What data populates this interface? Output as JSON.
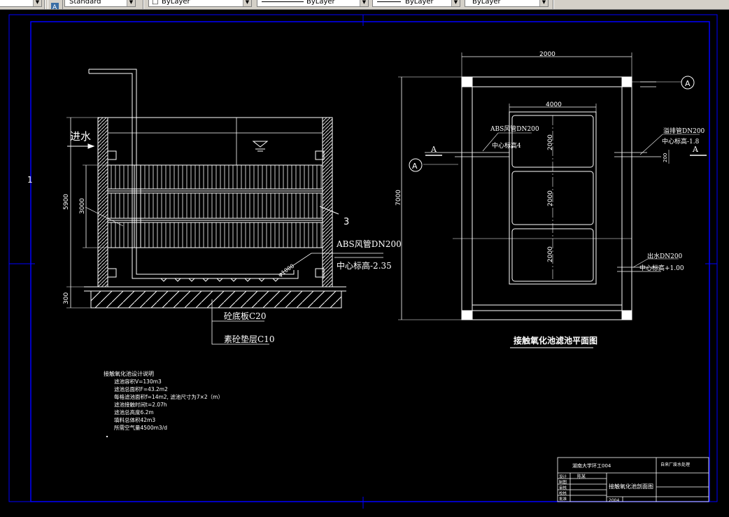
{
  "toolbar": {
    "text_style_value": "Standard",
    "layer_value": "ByLayer",
    "linetype_value": "ByLayer",
    "lineweight_value": "ByLayer",
    "plotstyle_value": "ByLayer"
  },
  "drawing": {
    "margin_number": "1",
    "section": {
      "inlet_label": "进水",
      "callout_3": "3",
      "dim_5900": "5900",
      "dim_3000": "3000",
      "dim_300": "300",
      "pipe_diameter": "φ1000",
      "abs_pipe_label": "ABS风管DN200",
      "center_elev_label": "中心标高-2.35",
      "slab_label": "砼底板C20",
      "cushion_label": "素砼垫层C10"
    },
    "plan": {
      "title": "接触氧化池滤池平面图",
      "dim_top": "2000",
      "dim_inner": "4000",
      "dim_left": "7000",
      "cell_dims": [
        "2000",
        "2000",
        "2000"
      ],
      "dim_200": "200",
      "section_mark_letter": "A",
      "abs_pipe_label": "ABS风管DN200",
      "abs_elev_label": "中心标高4",
      "drain_pipe_label": "溢排管DN200",
      "drain_elev_label": "中心标高-1.8",
      "outlet_pipe_label": "出水DN200",
      "outlet_elev_label": "中心标高+1.00"
    },
    "notes": {
      "title": "接触氧化池设计说明",
      "lines": [
        "滤池容积V=130m3",
        "滤池总面积F=43.2m2",
        "每格滤池面积f=14m2, 滤池尺寸为7×2（m）",
        "滤池接触时间t=2.07h",
        "滤池总高度6.2m",
        "填料总体积42m3",
        "所需空气量4500m3/d"
      ]
    },
    "title_block": {
      "school": "湖南大学环工004",
      "project": "自来厂废水处理",
      "drawing_title": "接触氧化池剖面图",
      "row_labels": [
        "设计",
        "制图",
        "审核",
        "校核",
        "批准"
      ],
      "designer": "陈某",
      "drawing_no": "2004"
    }
  },
  "colors": {
    "background": "#000000",
    "frame": "#0000ff",
    "lines": "#ffffff",
    "toolbar": "#d4d0c8"
  }
}
